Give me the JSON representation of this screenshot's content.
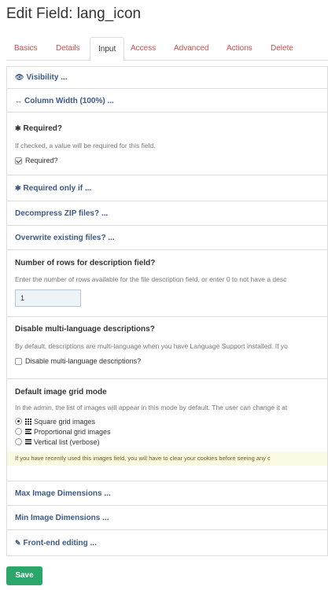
{
  "page": {
    "title": "Edit Field: lang_icon"
  },
  "tabs": [
    {
      "label": "Basics"
    },
    {
      "label": "Details"
    },
    {
      "label": "Input"
    },
    {
      "label": "Access"
    },
    {
      "label": "Advanced"
    },
    {
      "label": "Actions"
    },
    {
      "label": "Delete"
    }
  ],
  "active_tab": "Input",
  "sections": {
    "visibility": {
      "label": "Visibility ...",
      "icon": "eye-icon"
    },
    "column_width": {
      "label": "Column Width (100%) ...",
      "icon": "arrows-horizontal-icon"
    },
    "required": {
      "label": "Required?",
      "icon": "asterisk-icon",
      "description": "If checked, a value will be required for this field.",
      "checkbox_label": "Required?",
      "checked": true
    },
    "required_if": {
      "label": "Required only if ...",
      "icon": "asterisk-icon"
    },
    "decompress": {
      "label": "Decompress ZIP files? ..."
    },
    "overwrite": {
      "label": "Overwrite existing files? ..."
    },
    "rows": {
      "label": "Number of rows for description field?",
      "description": "Enter the number of rows available for the file description field, or enter 0 to not have a desc",
      "value": "1"
    },
    "multilang": {
      "label": "Disable multi-language descriptions?",
      "description": "By default, descriptions are multi-language when you have Language Support installed. If yo",
      "checkbox_label": "Disable multi-language descriptions?",
      "checked": false
    },
    "grid_mode": {
      "label": "Default image grid mode",
      "description": "In the admin, the list of images will appear in this mode by default. The user can change it at",
      "options": [
        {
          "label": "Square grid images",
          "checked": true
        },
        {
          "label": "Proportional grid images",
          "checked": false
        },
        {
          "label": "Vertical list (verbose)",
          "checked": false
        }
      ],
      "notice": "If you have recently used this images field, you will have to clear your cookies before seeing any c"
    },
    "max_dims": {
      "label": "Max Image Dimensions ..."
    },
    "min_dims": {
      "label": "Min Image Dimensions ..."
    },
    "frontend": {
      "label": "Front-end editing ...",
      "icon": "edit-icon"
    }
  },
  "actions": {
    "save_label": "Save"
  },
  "colors": {
    "link": "#3c5a86",
    "tab_link": "#d44a4a",
    "save": "#2aa66a",
    "notice_bg": "#fbfbe3"
  }
}
